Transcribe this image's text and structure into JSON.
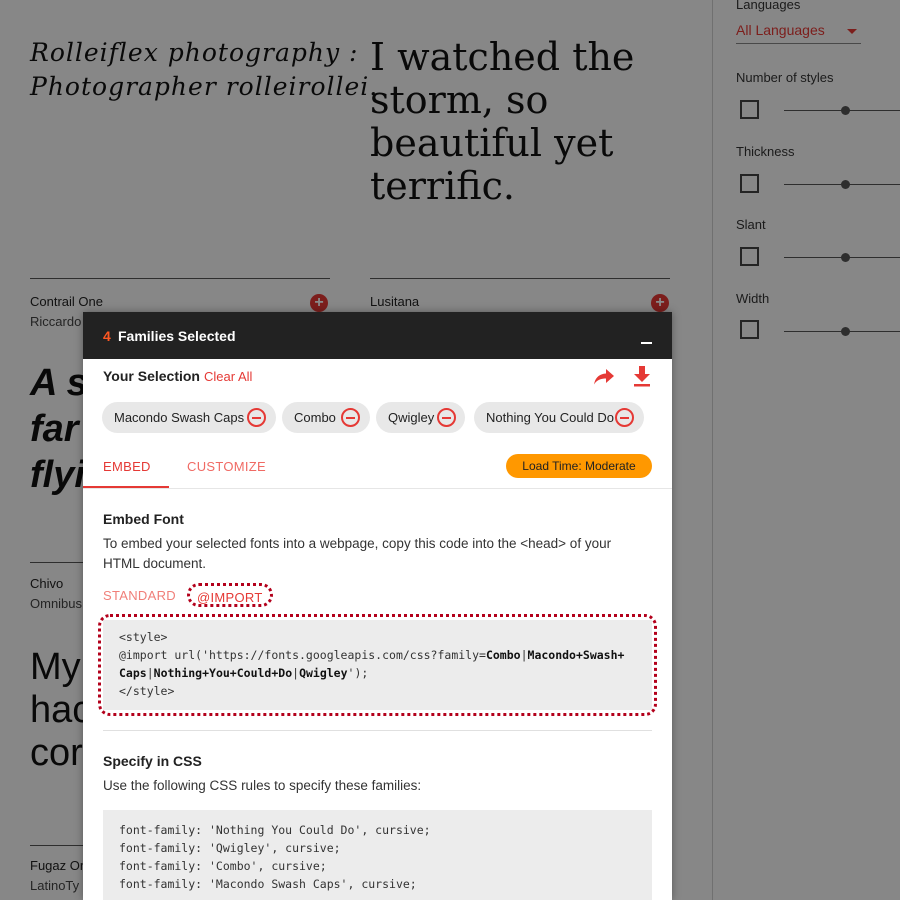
{
  "background": {
    "cards": [
      {
        "sample_lines": [
          "Rolleiflex photography :",
          "Photographer rolleirollei."
        ]
      },
      {
        "sample_lines": [
          "I watched the",
          "storm, so",
          "beautiful yet",
          "terrific."
        ]
      },
      {
        "name": "Contrail One",
        "author": "Riccardo",
        "sample_lines": [
          "A sh",
          "far",
          "flyi"
        ]
      },
      {
        "name": "Lusitana"
      },
      {
        "name": "Chivo",
        "author": "Omnibus",
        "sample_lines": [
          "My",
          "hac",
          "cor"
        ]
      },
      {
        "name": "Fugaz Or",
        "author": "LatinoTy"
      }
    ]
  },
  "sidebar": {
    "languages_label": "Languages",
    "languages_value": "All Languages",
    "filters": [
      {
        "label": "Number of styles"
      },
      {
        "label": "Thickness"
      },
      {
        "label": "Slant"
      },
      {
        "label": "Width"
      }
    ]
  },
  "drawer": {
    "count": "4",
    "title": "Families Selected",
    "your_selection": "Your Selection",
    "clear_all": "Clear All",
    "chips": [
      "Macondo Swash Caps",
      "Combo",
      "Qwigley",
      "Nothing You Could Do"
    ],
    "tabs": {
      "embed": "EMBED",
      "customize": "CUSTOMIZE"
    },
    "load_time": "Load Time: Moderate",
    "embed_title": "Embed Font",
    "embed_desc": "To embed your selected fonts into a webpage, copy this code into the <head> of your HTML document.",
    "subtabs": {
      "standard": "STANDARD",
      "import": "@IMPORT"
    },
    "code": {
      "line1": "<style>",
      "line2_prefix": "@import url('https://fonts.googleapis.com/css?family=",
      "line2_combo": "Combo",
      "line2_sep1": "|",
      "line2_macondo": "Macondo+Swash+",
      "line3_caps": "Caps",
      "line3_sep1": "|",
      "line3_nothing": "Nothing+You+Could+Do",
      "line3_sep2": "|",
      "line3_qwigley": "Qwigley",
      "line3_suffix": "');",
      "line4": "</style>"
    },
    "css_title": "Specify in CSS",
    "css_desc": "Use the following CSS rules to specify these families:",
    "css_rules": [
      "font-family: 'Nothing You Could Do', cursive;",
      "font-family: 'Qwigley', cursive;",
      "font-family: 'Combo', cursive;",
      "font-family: 'Macondo Swash Caps', cursive;"
    ]
  }
}
